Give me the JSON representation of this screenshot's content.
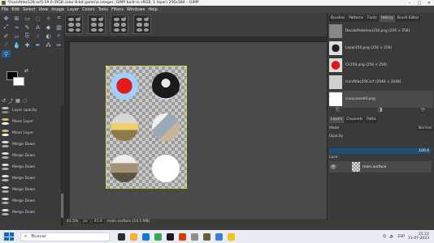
{
  "window": {
    "title": "*[IconAtlas128.xcf]-19.0 (RGB color 8-bit gamma integer, GIMP built-in sRGB, 1 layer) 256x384 – GIMP",
    "controls": [
      "–",
      "□",
      "✕"
    ]
  },
  "menubar": {
    "items": [
      "File",
      "Edit",
      "Select",
      "View",
      "Image",
      "Layer",
      "Colors",
      "Tools",
      "Filters",
      "Windows",
      "Help"
    ]
  },
  "toolbox": {
    "history_tabs": [
      "↺",
      "⤴",
      "▦",
      "◌"
    ],
    "history": [
      "Layer opacity",
      "Move Layer",
      "Move Layer",
      "Merge Down",
      "Merge Down",
      "Merge Down",
      "Merge Down",
      "Merge Down",
      "Merge Down",
      "Merge Down"
    ]
  },
  "documents_dock": {
    "tabs": [
      "Brushes",
      "Patterns",
      "Fonts",
      "History",
      "Brush Editor"
    ],
    "items": [
      "DecalsPokemon256.png (256 × 256)",
      "Layer256.png (256 × 256)",
      "Cir256.png (256 × 256)",
      "IconAtlas256.xcf (2048 × 2048)",
      "IconLeave64.png"
    ]
  },
  "layers_dock": {
    "tabs": [
      "Layers",
      "Channels",
      "Paths"
    ],
    "mode_label": "Mode",
    "mode_value": "Normal",
    "opacity_label": "Opacity",
    "opacity_value": "100.0",
    "lock_label": "Lock:",
    "layer_name": "main surface"
  },
  "statusbar": {
    "zoom": "41.5%",
    "unit": "px",
    "zoom_box": "45.8",
    "info": "main surface (14.5 MB)"
  },
  "taskbar": {
    "search_placeholder": "Buscar",
    "language": "ESP",
    "time": "21:22",
    "date": "11-07-2023"
  },
  "colors": {
    "foreground": "#000000",
    "background": "#ffffff",
    "accent": "#1f5e8c"
  }
}
